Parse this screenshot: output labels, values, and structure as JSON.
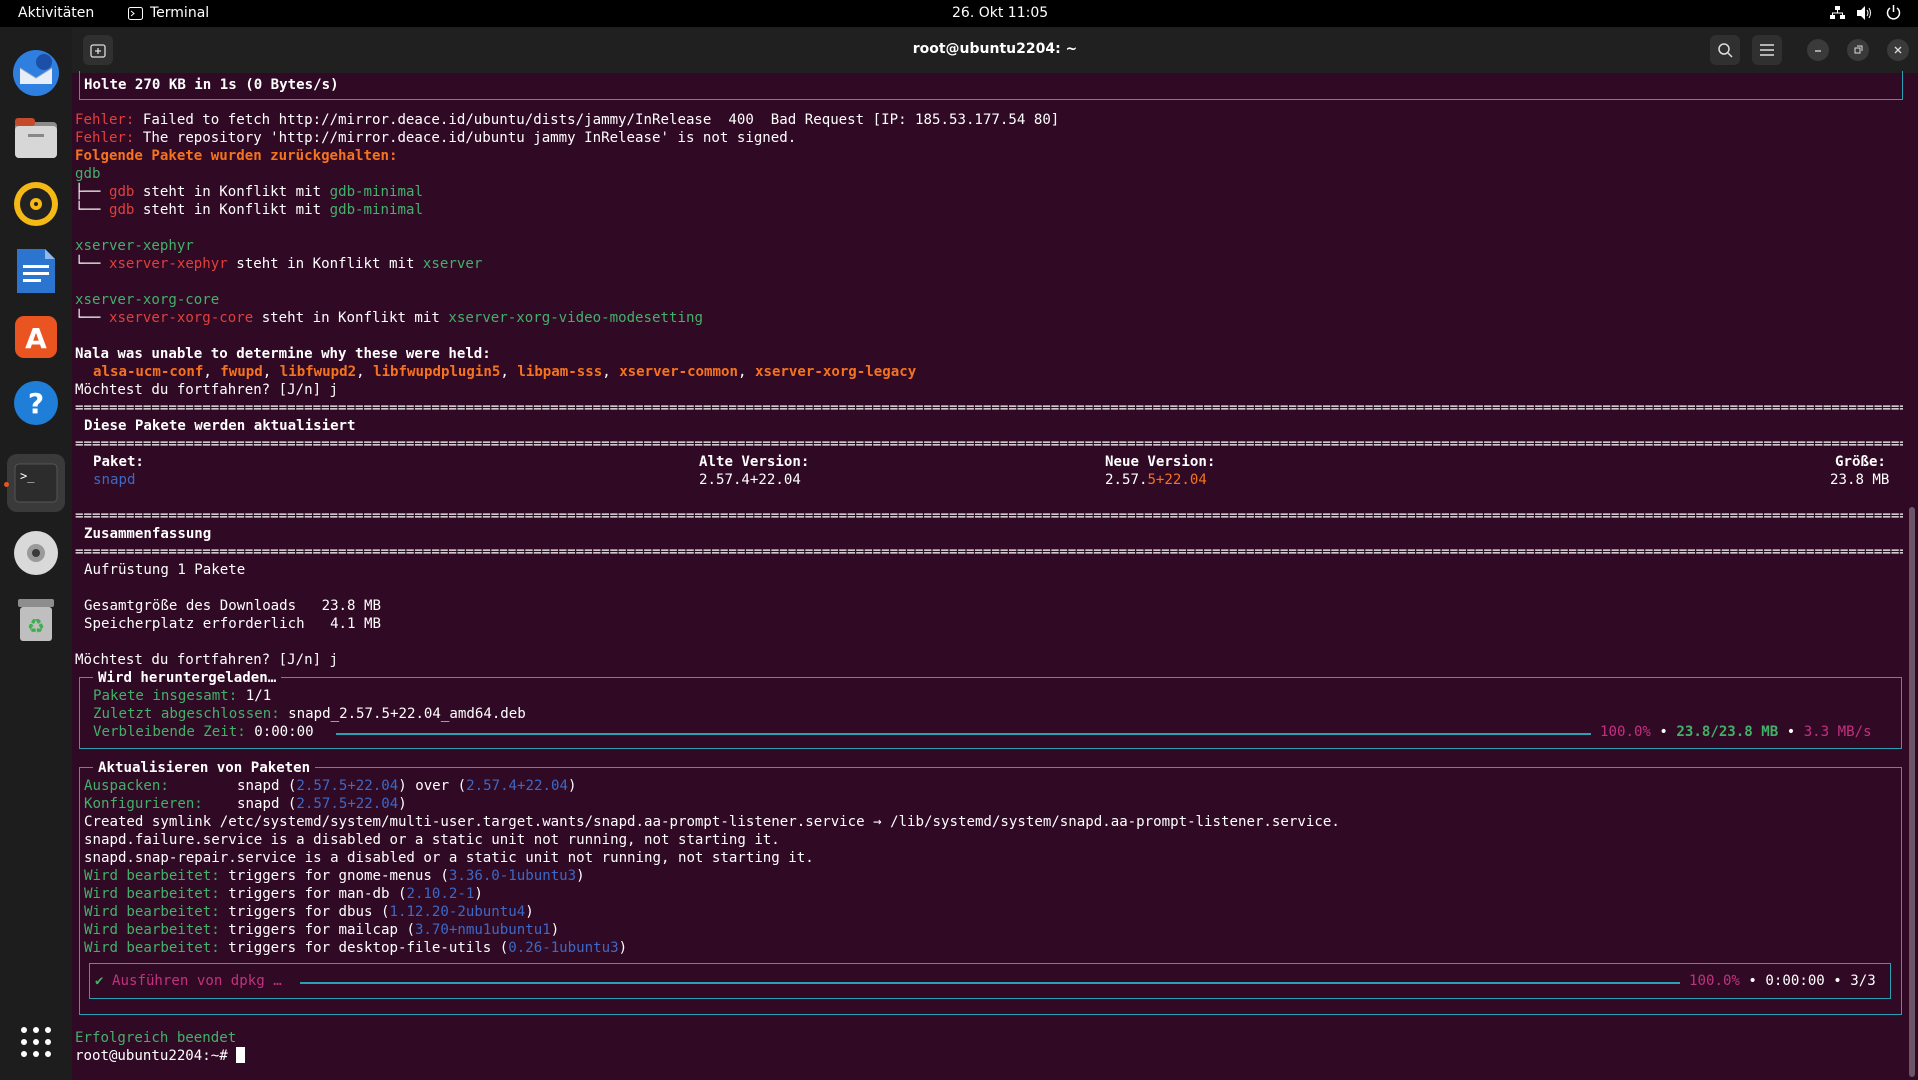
{
  "topbar": {
    "activities": "Aktivitäten",
    "app_name": "Terminal",
    "clock": "26. Okt 11:05"
  },
  "window": {
    "title": "root@ubuntu2204: ~"
  },
  "colors": {
    "accent_cyan": "#2aa1b3",
    "terminal_bg": "#300a24",
    "error_red": "#e0403b",
    "orange": "#f5731e",
    "green": "#43b06a",
    "blue": "#3d68c6"
  },
  "terminal": {
    "fetched": "Holte 270 KB in 1s (0 Bytes/s)",
    "err_label": "Fehler:",
    "err1": " Failed to fetch http://mirror.deace.id/ubuntu/dists/jammy/InRelease  400  Bad Request [IP: 185.53.177.54 80]",
    "err2": " The repository 'http://mirror.deace.id/ubuntu jammy InRelease' is not signed.",
    "held_title": "Folgende Pakete wurden zurückgehalten:",
    "held": [
      {
        "pkg": "gdb",
        "conflicts": [
          {
            "a": "gdb",
            "text": " steht in Konflikt mit ",
            "b": "gdb-minimal"
          },
          {
            "a": "gdb",
            "text": " steht in Konflikt mit ",
            "b": "gdb-minimal"
          }
        ]
      },
      {
        "pkg": "xserver-xephyr",
        "conflicts": [
          {
            "a": "xserver-xephyr",
            "text": " steht in Konflikt mit ",
            "b": "xserver"
          }
        ]
      },
      {
        "pkg": "xserver-xorg-core",
        "conflicts": [
          {
            "a": "xserver-xorg-core",
            "text": " steht in Konflikt mit ",
            "b": "xserver-xorg-video-modesetting"
          }
        ]
      }
    ],
    "tree_branch": "├── ",
    "tree_last": "└── ",
    "unable": "Nala was unable to determine why these were held:",
    "unable_pkgs": [
      "alsa-ucm-conf",
      "fwupd",
      "libfwupd2",
      "libfwupdplugin5",
      "libpam-sss",
      "xserver-common",
      "xserver-xorg-legacy"
    ],
    "prompt1": "Möchtest du fortfahren? [J/n] j",
    "upgrade_title": "Diese Pakete werden aktualisiert",
    "table": {
      "col_pkg": "Paket:",
      "col_old": "Alte Version:",
      "col_new": "Neue Version:",
      "col_size": "Größe:",
      "pkg": "snapd",
      "old": "2.57.4+22.04",
      "new_prefix": "2.57.",
      "new_suffix": "5+22.04",
      "size": "23.8 MB"
    },
    "summary_title": "Zusammenfassung",
    "summary_upgrade": "Aufrüstung 1 Pakete",
    "summary_download": "Gesamtgröße des Downloads   23.8 MB",
    "summary_space": "Speicherplatz erforderlich   4.1 MB",
    "prompt2": "Möchtest du fortfahren? [J/n] j",
    "download": {
      "title": "Wird heruntergeladen…",
      "total_label": "Pakete insgesamt:",
      "total_value": " 1/1",
      "last_label": "Zuletzt abgeschlossen:",
      "last_value": " snapd_2.57.5+22.04_amd64.deb",
      "remaining_label": "Verbleibende Zeit:",
      "remaining_value": " 0:00:00",
      "percent": "100.0%",
      "size": "23.8/23.8 MB",
      "speed": "3.3 MB/s",
      "progress": 1.0
    },
    "update": {
      "title": "Aktualisieren von Paketen",
      "unpack_label": "Auspacken:",
      "unpack_pkg": "snapd (",
      "unpack_new": "2.57.5+22.04",
      "unpack_over": ") over (",
      "unpack_old": "2.57.4+22.04",
      "close": ")",
      "config_label": "Konfigurieren:",
      "config_pkg": "snapd (",
      "config_ver": "2.57.5+22.04",
      "symlink": "Created symlink /etc/systemd/system/multi-user.target.wants/snapd.aa-prompt-listener.service → /lib/systemd/system/snapd.aa-prompt-listener.service.",
      "failure": "snapd.failure.service is a disabled or a static unit not running, not starting it.",
      "repair": "snapd.snap-repair.service is a disabled or a static unit not running, not starting it.",
      "proc_label": "Wird bearbeitet:",
      "triggers": [
        {
          "text": " triggers for gnome-menus (",
          "ver": "3.36.0-1ubuntu3"
        },
        {
          "text": " triggers for man-db (",
          "ver": "2.10.2-1"
        },
        {
          "text": " triggers for dbus (",
          "ver": "1.12.20-2ubuntu4"
        },
        {
          "text": " triggers for mailcap (",
          "ver": "3.70+nmu1ubuntu1"
        },
        {
          "text": " triggers for desktop-file-utils (",
          "ver": "0.26-1ubuntu3"
        }
      ],
      "dpkg_check": "✔",
      "dpkg_label": "Ausführen von dpkg …",
      "dpkg_percent": "100.0%",
      "dpkg_time": "0:00:00",
      "dpkg_count": "3/3",
      "progress": 1.0
    },
    "done": "Erfolgreich beendet",
    "prompt": "root@ubuntu2204:~# "
  }
}
